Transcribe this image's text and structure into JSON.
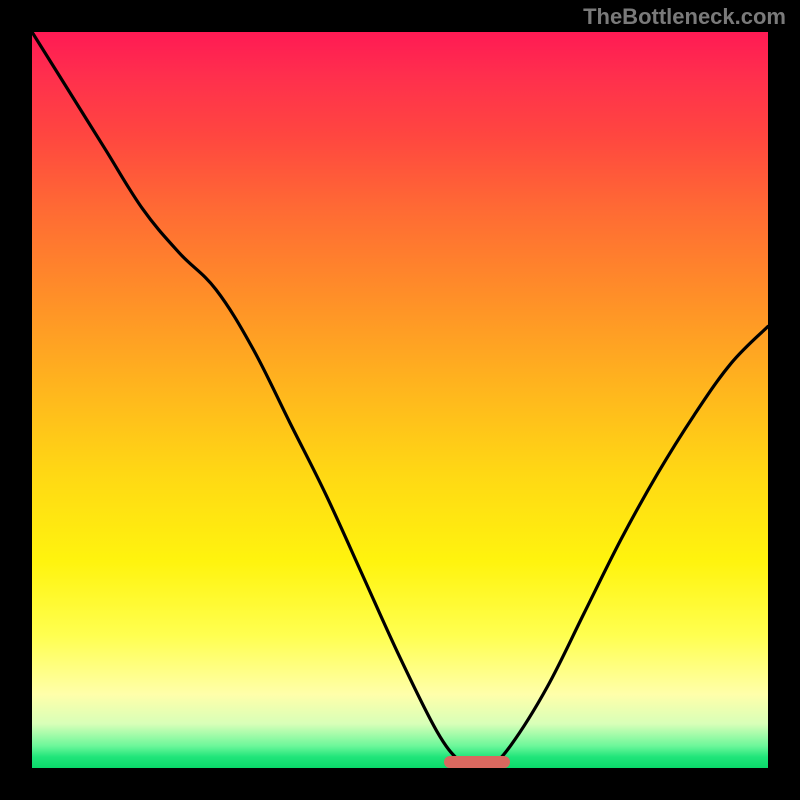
{
  "attribution": "TheBottleneck.com",
  "colors": {
    "frame": "#000000",
    "curve": "#000000",
    "marker": "#d9685f",
    "attribution_text": "#7a7a7a"
  },
  "chart_data": {
    "type": "line",
    "title": "",
    "xlabel": "",
    "ylabel": "",
    "xlim": [
      0,
      100
    ],
    "ylim": [
      0,
      100
    ],
    "series": [
      {
        "name": "bottleneck-curve",
        "x": [
          0,
          5,
          10,
          15,
          20,
          25,
          30,
          35,
          40,
          45,
          50,
          55,
          58,
          60,
          62,
          65,
          70,
          75,
          80,
          85,
          90,
          95,
          100
        ],
        "values": [
          100,
          92,
          84,
          76,
          70,
          65,
          57,
          47,
          37,
          26,
          15,
          5,
          1,
          0,
          0,
          3,
          11,
          21,
          31,
          40,
          48,
          55,
          60
        ]
      }
    ],
    "marker": {
      "x_start": 56,
      "x_end": 65,
      "y": 0
    },
    "gradient_stops": [
      {
        "pos": 0,
        "color": "#ff1a54"
      },
      {
        "pos": 0.24,
        "color": "#ff6a34"
      },
      {
        "pos": 0.6,
        "color": "#ffd814"
      },
      {
        "pos": 0.9,
        "color": "#ffffaa"
      },
      {
        "pos": 1.0,
        "color": "#0ad96a"
      }
    ]
  }
}
